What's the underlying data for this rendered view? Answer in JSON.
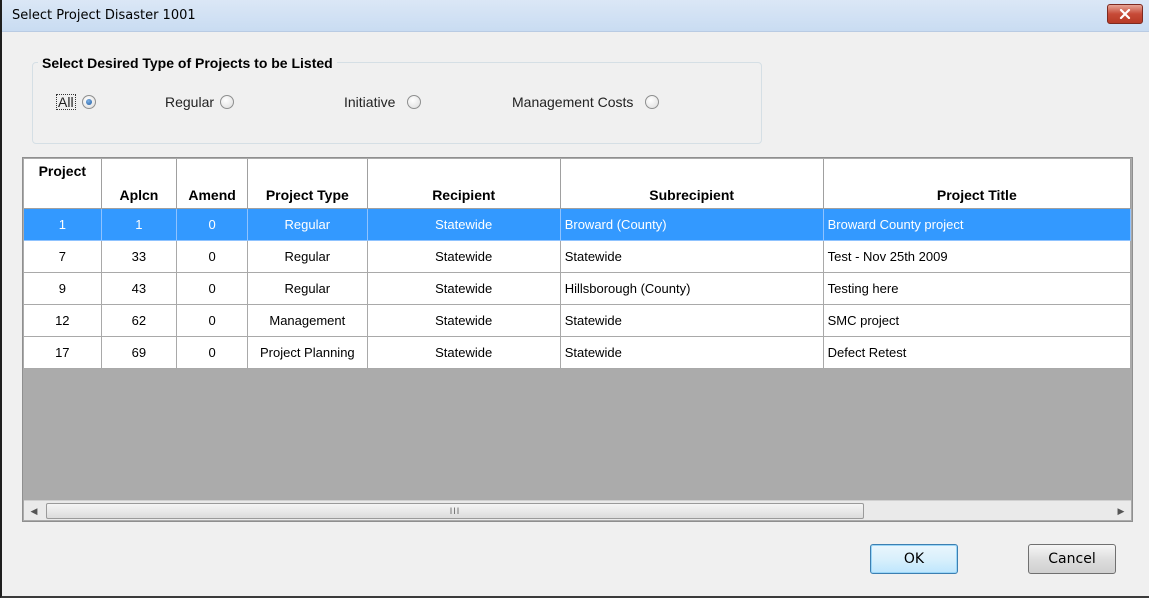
{
  "window": {
    "title": "Select Project   Disaster 1001"
  },
  "filter": {
    "legend": "Select Desired Type of Projects to be Listed",
    "options": [
      {
        "label": "All",
        "checked": true
      },
      {
        "label": "Regular",
        "checked": false
      },
      {
        "label": "Initiative",
        "checked": false
      },
      {
        "label": "Management Costs",
        "checked": false
      }
    ]
  },
  "grid": {
    "columns": [
      "Project",
      "Aplcn",
      "Amend",
      "Project Type",
      "Recipient",
      "Subrecipient",
      "Project Title"
    ],
    "rows": [
      {
        "project": "1",
        "aplcn": "1",
        "amend": "0",
        "type": "Regular",
        "recipient": "Statewide",
        "subrecipient": "Broward (County)",
        "title": "Broward County project",
        "selected": true
      },
      {
        "project": "7",
        "aplcn": "33",
        "amend": "0",
        "type": "Regular",
        "recipient": "Statewide",
        "subrecipient": "Statewide",
        "title": "Test - Nov 25th 2009",
        "selected": false
      },
      {
        "project": "9",
        "aplcn": "43",
        "amend": "0",
        "type": "Regular",
        "recipient": "Statewide",
        "subrecipient": "Hillsborough (County)",
        "title": "Testing here",
        "selected": false
      },
      {
        "project": "12",
        "aplcn": "62",
        "amend": "0",
        "type": "Management",
        "recipient": "Statewide",
        "subrecipient": "Statewide",
        "title": "SMC project",
        "selected": false
      },
      {
        "project": "17",
        "aplcn": "69",
        "amend": "0",
        "type": "Project Planning",
        "recipient": "Statewide",
        "subrecipient": "Statewide",
        "title": "Defect Retest",
        "selected": false
      }
    ],
    "scroll_thumb_grip": "III"
  },
  "buttons": {
    "ok": "OK",
    "cancel": "Cancel"
  },
  "colors": {
    "selection": "#3399ff",
    "close_button": "#c74a37"
  }
}
